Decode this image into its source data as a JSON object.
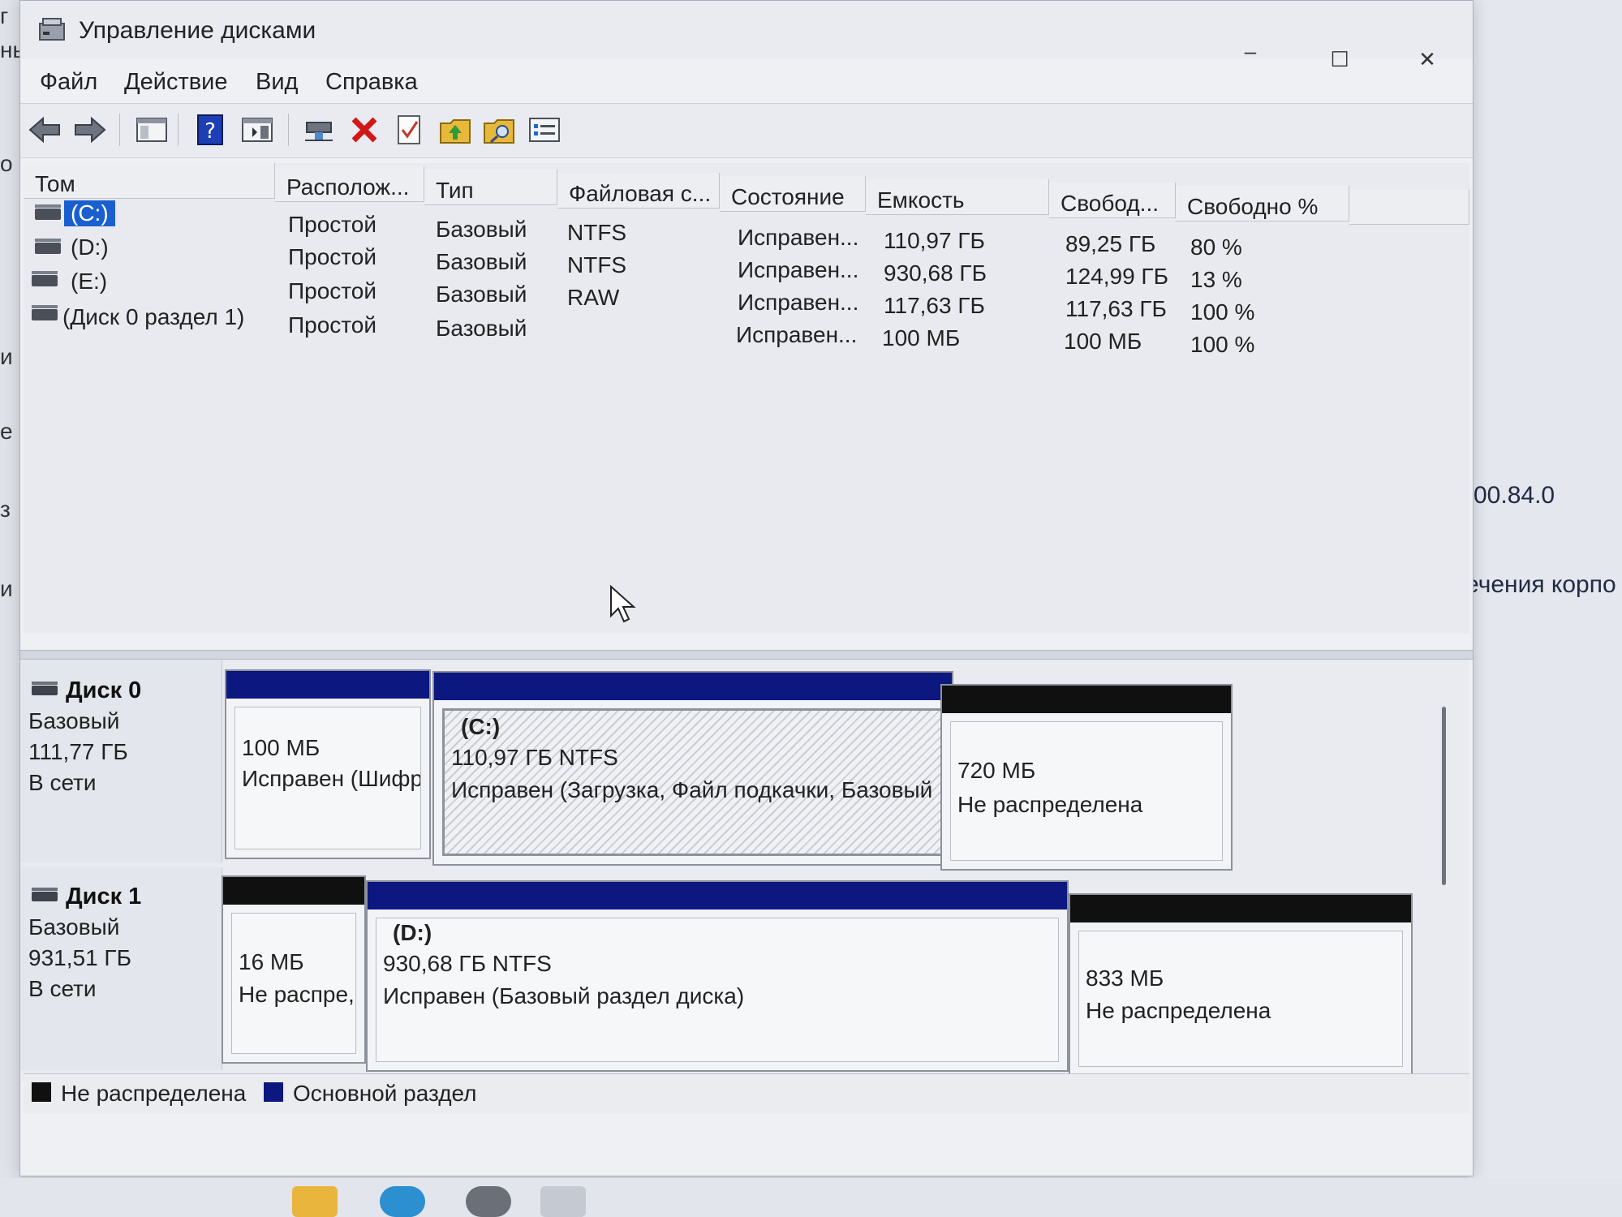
{
  "window": {
    "title": "Управление дисками",
    "controls": {
      "minimize": "–",
      "maximize": "☐",
      "close": "✕"
    }
  },
  "menu": [
    "Файл",
    "Действие",
    "Вид",
    "Справка"
  ],
  "toolbar_icons": [
    "back-icon",
    "forward-icon",
    "console-tree-icon",
    "help-icon",
    "action-pane-icon",
    "connect-icon",
    "delete-icon",
    "check-icon",
    "folder-up-icon",
    "search-folder-icon",
    "properties-list-icon"
  ],
  "volume_table": {
    "headers": [
      "Том",
      "Располож...",
      "Тип",
      "Файловая с...",
      "Состояние",
      "Емкость",
      "Свобод...",
      "Свободно %"
    ],
    "rows": [
      {
        "volume": "(C:)",
        "layout": "Простой",
        "type": "Базовый",
        "fs": "NTFS",
        "status": "Исправен...",
        "capacity": "110,97 ГБ",
        "free": "89,25 ГБ",
        "free_pct": "80 %"
      },
      {
        "volume": "(D:)",
        "layout": "Простой",
        "type": "Базовый",
        "fs": "NTFS",
        "status": "Исправен...",
        "capacity": "930,68 ГБ",
        "free": "124,99 ГБ",
        "free_pct": "13 %"
      },
      {
        "volume": "(E:)",
        "layout": "Простой",
        "type": "Базовый",
        "fs": "RAW",
        "status": "Исправен...",
        "capacity": "117,63 ГБ",
        "free": "117,63 ГБ",
        "free_pct": "100 %"
      },
      {
        "volume": "(Диск 0 раздел 1)",
        "layout": "Простой",
        "type": "Базовый",
        "fs": "",
        "status": "Исправен...",
        "capacity": "100 МБ",
        "free": "100 МБ",
        "free_pct": "100 %"
      }
    ]
  },
  "disks": [
    {
      "name": "Диск 0",
      "kind": "Базовый",
      "size": "111,77 ГБ",
      "state": "В сети",
      "partitions": [
        {
          "title": "",
          "line1": "100 МБ",
          "line2": "Исправен (Шифр"
        },
        {
          "title": "(C:)",
          "line1": "110,97 ГБ NTFS",
          "line2": "Исправен (Загрузка, Файл подкачки, Базовый"
        },
        {
          "title": "",
          "line1": "720 МБ",
          "line2": "Не распределена"
        }
      ]
    },
    {
      "name": "Диск 1",
      "kind": "Базовый",
      "size": "931,51 ГБ",
      "state": "В сети",
      "partitions": [
        {
          "title": "",
          "line1": "16 МБ",
          "line2": "Не распре,"
        },
        {
          "title": "(D:)",
          "line1": "930,68 ГБ NTFS",
          "line2": "Исправен (Базовый раздел диска)"
        },
        {
          "title": "",
          "line1": "833 МБ",
          "line2": "Не распределена"
        }
      ]
    }
  ],
  "legend": [
    {
      "label": "Не распределена",
      "color": "#101010"
    },
    {
      "label": "Основной раздел",
      "color": "#0c1780"
    }
  ],
  "background": {
    "version": "00.84.0",
    "fragment": "ечения корпо",
    "left_chars": [
      "г",
      "нь",
      "о",
      "и",
      "е",
      "з",
      "и"
    ]
  },
  "colors": {
    "primary_partition": "#0c1780",
    "unallocated": "#101010",
    "selection": "#1a5fd0"
  }
}
